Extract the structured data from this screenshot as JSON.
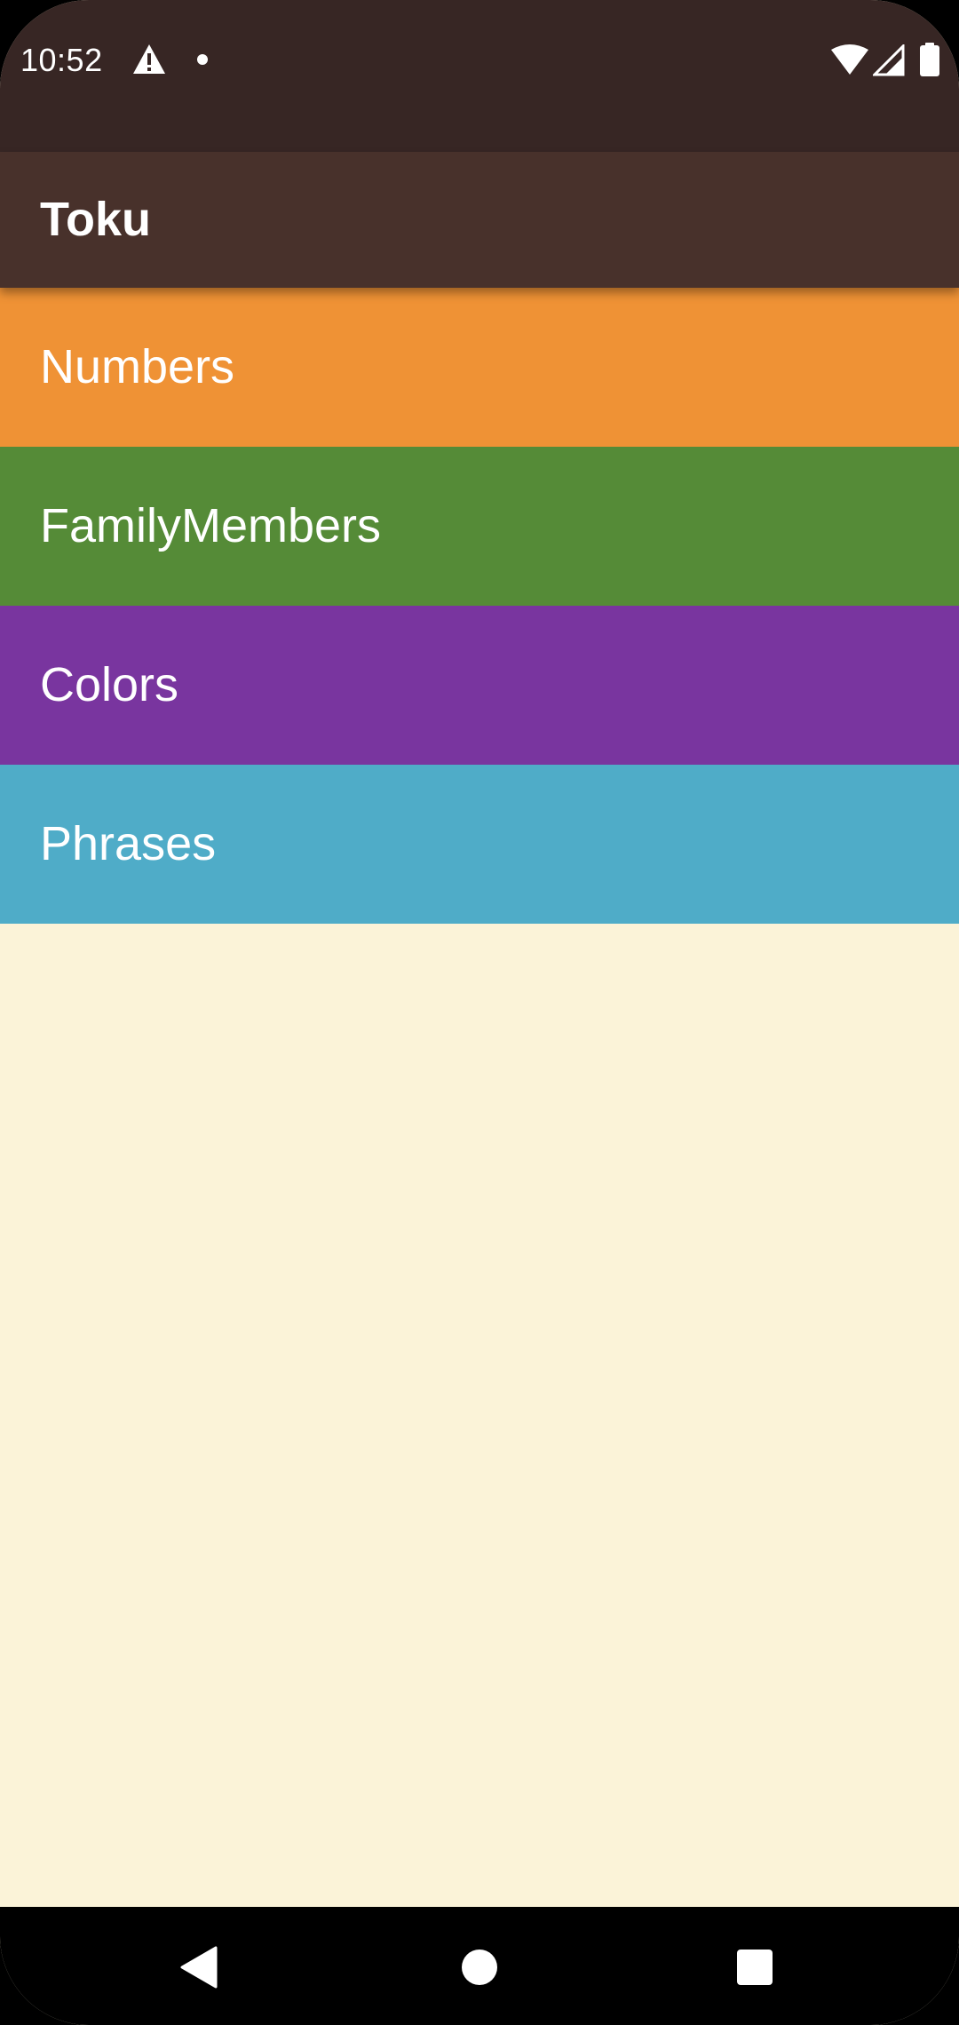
{
  "status_bar": {
    "time": "10:52",
    "left_icons": [
      "warning-icon",
      "notification-dot-icon"
    ],
    "right_icons": [
      "wifi-icon",
      "signal-icon",
      "battery-icon"
    ],
    "background": "#372624"
  },
  "app_bar": {
    "title": "Toku",
    "background": "#48312B"
  },
  "categories": [
    {
      "label": "Numbers",
      "color": "#EF9235"
    },
    {
      "label": "FamilyMembers",
      "color": "#558B37"
    },
    {
      "label": "Colors",
      "color": "#79359F"
    },
    {
      "label": "Phrases",
      "color": "#4FACC8"
    }
  ],
  "content_background": "#FBF3D8",
  "nav_bar": {
    "buttons": [
      "back-icon",
      "home-icon",
      "recents-icon"
    ]
  }
}
